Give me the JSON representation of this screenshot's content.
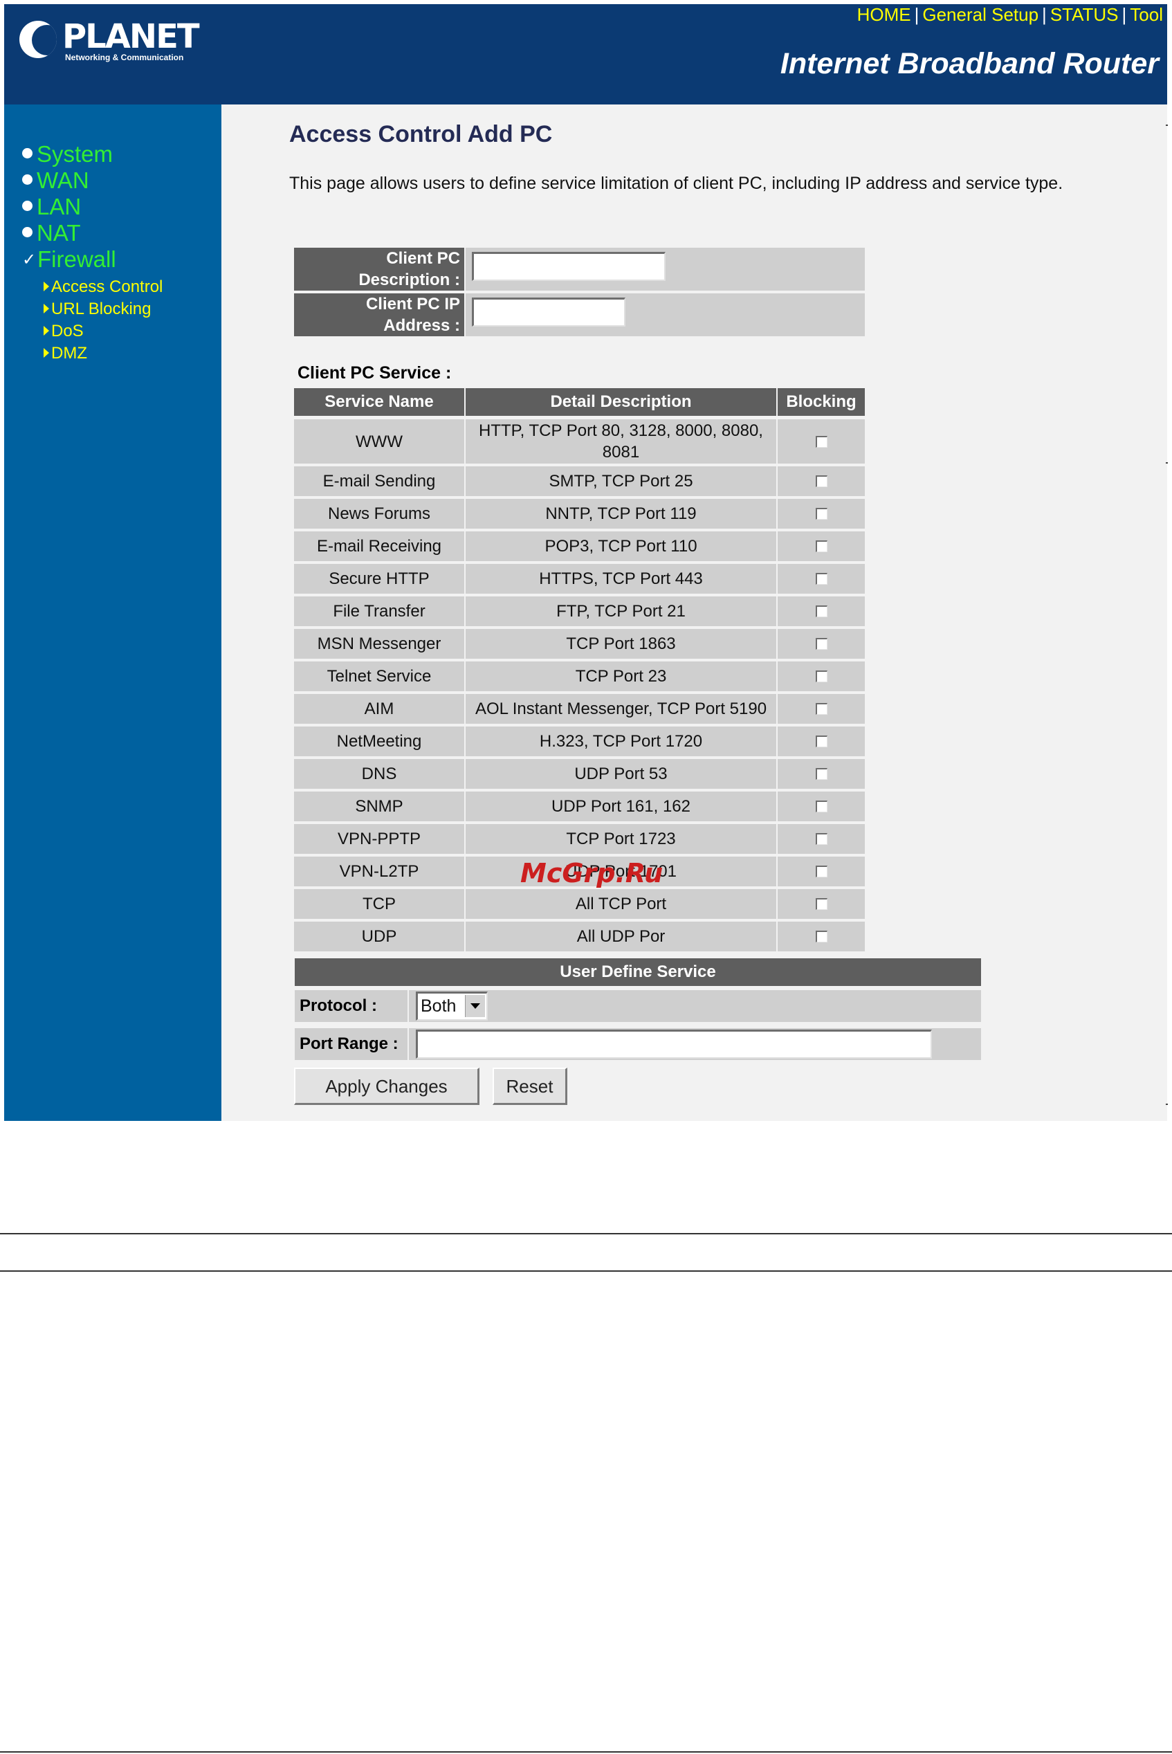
{
  "header": {
    "brand": "PLANET",
    "brand_tagline": "Networking & Communication",
    "product_title": "Internet Broadband Router",
    "top_links": [
      "HOME",
      "General Setup",
      "STATUS",
      "Tool"
    ],
    "separator": "|"
  },
  "sidebar": {
    "items": [
      {
        "label": "System",
        "marker": "dot"
      },
      {
        "label": "WAN",
        "marker": "dot"
      },
      {
        "label": "LAN",
        "marker": "dot"
      },
      {
        "label": "NAT",
        "marker": "dot"
      },
      {
        "label": "Firewall",
        "marker": "check"
      }
    ],
    "sub_items": [
      "Access Control",
      "URL Blocking",
      "DoS",
      "DMZ"
    ]
  },
  "main": {
    "title": "Access Control Add PC",
    "description": "This page allows users to define service limitation of client PC, including IP address and service type.",
    "client_desc_label_1": "Client PC",
    "client_desc_label_2": "Description :",
    "client_desc_value": "",
    "client_ip_label_1": "Client PC IP",
    "client_ip_label_2": "Address :",
    "client_ip_value": "",
    "service_caption": "Client PC Service :",
    "table_headers": [
      "Service Name",
      "Detail Description",
      "Blocking"
    ],
    "services": [
      {
        "name": "WWW",
        "detail": "HTTP, TCP Port 80, 3128, 8000, 8080, 8081",
        "blocked": false
      },
      {
        "name": "E-mail Sending",
        "detail": "SMTP, TCP Port 25",
        "blocked": false
      },
      {
        "name": "News Forums",
        "detail": "NNTP, TCP Port 119",
        "blocked": false
      },
      {
        "name": "E-mail Receiving",
        "detail": "POP3, TCP Port 110",
        "blocked": false
      },
      {
        "name": "Secure HTTP",
        "detail": "HTTPS, TCP Port 443",
        "blocked": false
      },
      {
        "name": "File Transfer",
        "detail": "FTP, TCP Port 21",
        "blocked": false
      },
      {
        "name": "MSN Messenger",
        "detail": "TCP Port 1863",
        "blocked": false
      },
      {
        "name": "Telnet Service",
        "detail": "TCP Port 23",
        "blocked": false
      },
      {
        "name": "AIM",
        "detail": "AOL Instant Messenger, TCP Port 5190",
        "blocked": false
      },
      {
        "name": "NetMeeting",
        "detail": "H.323, TCP Port 1720",
        "blocked": false
      },
      {
        "name": "DNS",
        "detail": "UDP Port 53",
        "blocked": false
      },
      {
        "name": "SNMP",
        "detail": "UDP Port 161, 162",
        "blocked": false
      },
      {
        "name": "VPN-PPTP",
        "detail": "TCP Port 1723",
        "blocked": false
      },
      {
        "name": "VPN-L2TP",
        "detail": "UDP Port 1701",
        "blocked": false
      },
      {
        "name": "TCP",
        "detail": "All TCP Port",
        "blocked": false
      },
      {
        "name": "UDP",
        "detail": "All UDP Por",
        "blocked": false
      }
    ],
    "user_define": {
      "header": "User Define Service",
      "protocol_label": "Protocol :",
      "protocol_value": "Both",
      "port_range_label": "Port Range :",
      "port_range_value": ""
    },
    "buttons": {
      "apply": "Apply Changes",
      "reset": "Reset"
    }
  },
  "watermark": "McGrp.Ru",
  "colors": {
    "header_bg": "#0b3a73",
    "sidebar_bg": "#00619f",
    "nav_link": "#33ee33",
    "sub_link": "#ffff00",
    "table_header_bg": "#5e5e5e",
    "table_cell_bg": "#cfcfcf",
    "title_color": "#242b55",
    "watermark": "#cc1f1f"
  }
}
